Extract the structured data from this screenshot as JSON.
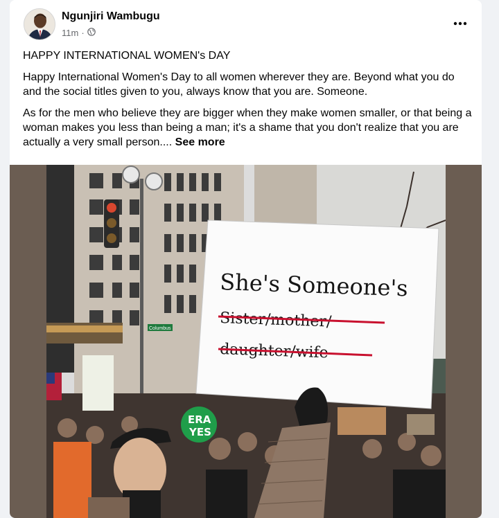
{
  "post": {
    "author": "Ngunjiri Wambugu",
    "time": "11m",
    "separator": "·",
    "title": "HAPPY INTERNATIONAL WOMEN's DAY",
    "para1": "Happy International Women's Day to all women wherever they are. Beyond what you do and the social titles given to you, always know that you are. Someone.",
    "para2": "As for the men who believe they are bigger when they make women smaller, or that being a woman makes you less than being a man; it's a shame that you don't realize that you are actually a very small person....",
    "see_more": "See more"
  },
  "icons": {
    "audience": "globe-icon",
    "menu": "more-options-icon"
  },
  "image": {
    "sign_line1": "She's Someone's",
    "sign_line2": "Sister/mother/",
    "sign_line3": "daughter/wife",
    "badge_line1": "ERA",
    "badge_line2": "YES",
    "street_sign": "Columbus"
  },
  "colors": {
    "text": "#050505",
    "secondary": "#65676b",
    "strike_red": "#c8102e",
    "badge_green": "#1f9e4a"
  }
}
